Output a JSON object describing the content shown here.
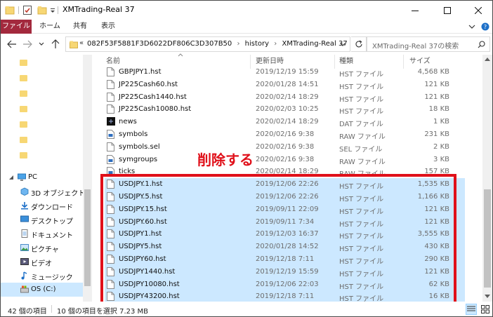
{
  "window": {
    "title": "XMTrading-Real 37"
  },
  "ribbon": {
    "tabs": [
      {
        "label": "ファイル"
      },
      {
        "label": "ホーム"
      },
      {
        "label": "共有"
      },
      {
        "label": "表示"
      }
    ]
  },
  "address": {
    "overflow": "«",
    "segments": [
      "082F53F5881F3D6022DF806C3D307B50",
      "history",
      "XMTrading-Real 37"
    ],
    "search_placeholder": "XMTrading-Real 37の検索"
  },
  "nav": {
    "items": [
      {
        "label": "PC",
        "icon": "pc-icon"
      },
      {
        "label": "3D オブジェクト",
        "icon": "3d-objects-icon"
      },
      {
        "label": "ダウンロード",
        "icon": "downloads-icon"
      },
      {
        "label": "デスクトップ",
        "icon": "desktop-icon"
      },
      {
        "label": "ドキュメント",
        "icon": "documents-icon"
      },
      {
        "label": "ピクチャ",
        "icon": "pictures-icon"
      },
      {
        "label": "ビデオ",
        "icon": "videos-icon"
      },
      {
        "label": "ミュージック",
        "icon": "music-icon"
      },
      {
        "label": "OS (C:)",
        "icon": "drive-icon"
      }
    ]
  },
  "columns": {
    "name": "名前",
    "date": "更新日時",
    "type": "種類",
    "size": "サイズ"
  },
  "files": [
    {
      "name": "GBPJPY1.hst",
      "date": "2019/12/19 15:59",
      "type": "HST ファイル",
      "size": "4,568 KB",
      "selected": false,
      "icon": "file-icon"
    },
    {
      "name": "JP225Cash60.hst",
      "date": "2020/01/28 14:51",
      "type": "HST ファイル",
      "size": "121 KB",
      "selected": false,
      "icon": "file-icon"
    },
    {
      "name": "JP225Cash1440.hst",
      "date": "2020/02/14 18:29",
      "type": "HST ファイル",
      "size": "121 KB",
      "selected": false,
      "icon": "file-icon"
    },
    {
      "name": "JP225Cash10080.hst",
      "date": "2020/02/03 10:25",
      "type": "HST ファイル",
      "size": "18 KB",
      "selected": false,
      "icon": "file-icon"
    },
    {
      "name": "news",
      "date": "2020/02/14 18:29",
      "type": "DAT ファイル",
      "size": "1 KB",
      "selected": false,
      "icon": "news-icon"
    },
    {
      "name": "symbols",
      "date": "2020/02/16 9:38",
      "type": "RAW ファイル",
      "size": "231 KB",
      "selected": false,
      "icon": "raw-file-icon"
    },
    {
      "name": "symbols.sel",
      "date": "2020/02/16 9:38",
      "type": "SEL ファイル",
      "size": "2 KB",
      "selected": false,
      "icon": "file-icon"
    },
    {
      "name": "symgroups",
      "date": "2020/02/16 9:38",
      "type": "RAW ファイル",
      "size": "3 KB",
      "selected": false,
      "icon": "raw-file-icon"
    },
    {
      "name": "ticks",
      "date": "2020/02/14 18:29",
      "type": "RAW ファイル",
      "size": "157 KB",
      "selected": false,
      "icon": "raw-file-icon"
    },
    {
      "name": "USDJPY.1.hst",
      "date": "2019/12/06 22:26",
      "type": "HST ファイル",
      "size": "1,535 KB",
      "selected": true,
      "icon": "file-icon"
    },
    {
      "name": "USDJPY.5.hst",
      "date": "2019/12/06 22:26",
      "type": "HST ファイル",
      "size": "1,166 KB",
      "selected": true,
      "icon": "file-icon"
    },
    {
      "name": "USDJPY.15.hst",
      "date": "2019/09/11 22:09",
      "type": "HST ファイル",
      "size": "121 KB",
      "selected": true,
      "icon": "file-icon"
    },
    {
      "name": "USDJPY.60.hst",
      "date": "2019/09/11 7:34",
      "type": "HST ファイル",
      "size": "121 KB",
      "selected": true,
      "icon": "file-icon"
    },
    {
      "name": "USDJPY1.hst",
      "date": "2019/12/03 16:37",
      "type": "HST ファイル",
      "size": "3,555 KB",
      "selected": true,
      "icon": "file-icon"
    },
    {
      "name": "USDJPY5.hst",
      "date": "2020/01/28 14:52",
      "type": "HST ファイル",
      "size": "430 KB",
      "selected": true,
      "icon": "file-icon"
    },
    {
      "name": "USDJPY60.hst",
      "date": "2019/12/18 7:11",
      "type": "HST ファイル",
      "size": "290 KB",
      "selected": true,
      "icon": "file-icon"
    },
    {
      "name": "USDJPY1440.hst",
      "date": "2019/12/19 15:59",
      "type": "HST ファイル",
      "size": "121 KB",
      "selected": true,
      "icon": "file-icon"
    },
    {
      "name": "USDJPY10080.hst",
      "date": "2019/12/06 22:03",
      "type": "HST ファイル",
      "size": "62 KB",
      "selected": true,
      "icon": "file-icon"
    },
    {
      "name": "USDJPY43200.hst",
      "date": "2019/12/18 7:11",
      "type": "HST ファイル",
      "size": "16 KB",
      "selected": true,
      "icon": "file-icon"
    }
  ],
  "annotation": {
    "label": "削除する",
    "color": "#e0101a"
  },
  "status": {
    "item_count": "42 個の項目",
    "selection": "10 個の項目を選択  7.23 MB"
  },
  "colors": {
    "accent_file_tab": "#a3293d",
    "selection": "#cce8ff",
    "folder": "#f7d774"
  }
}
